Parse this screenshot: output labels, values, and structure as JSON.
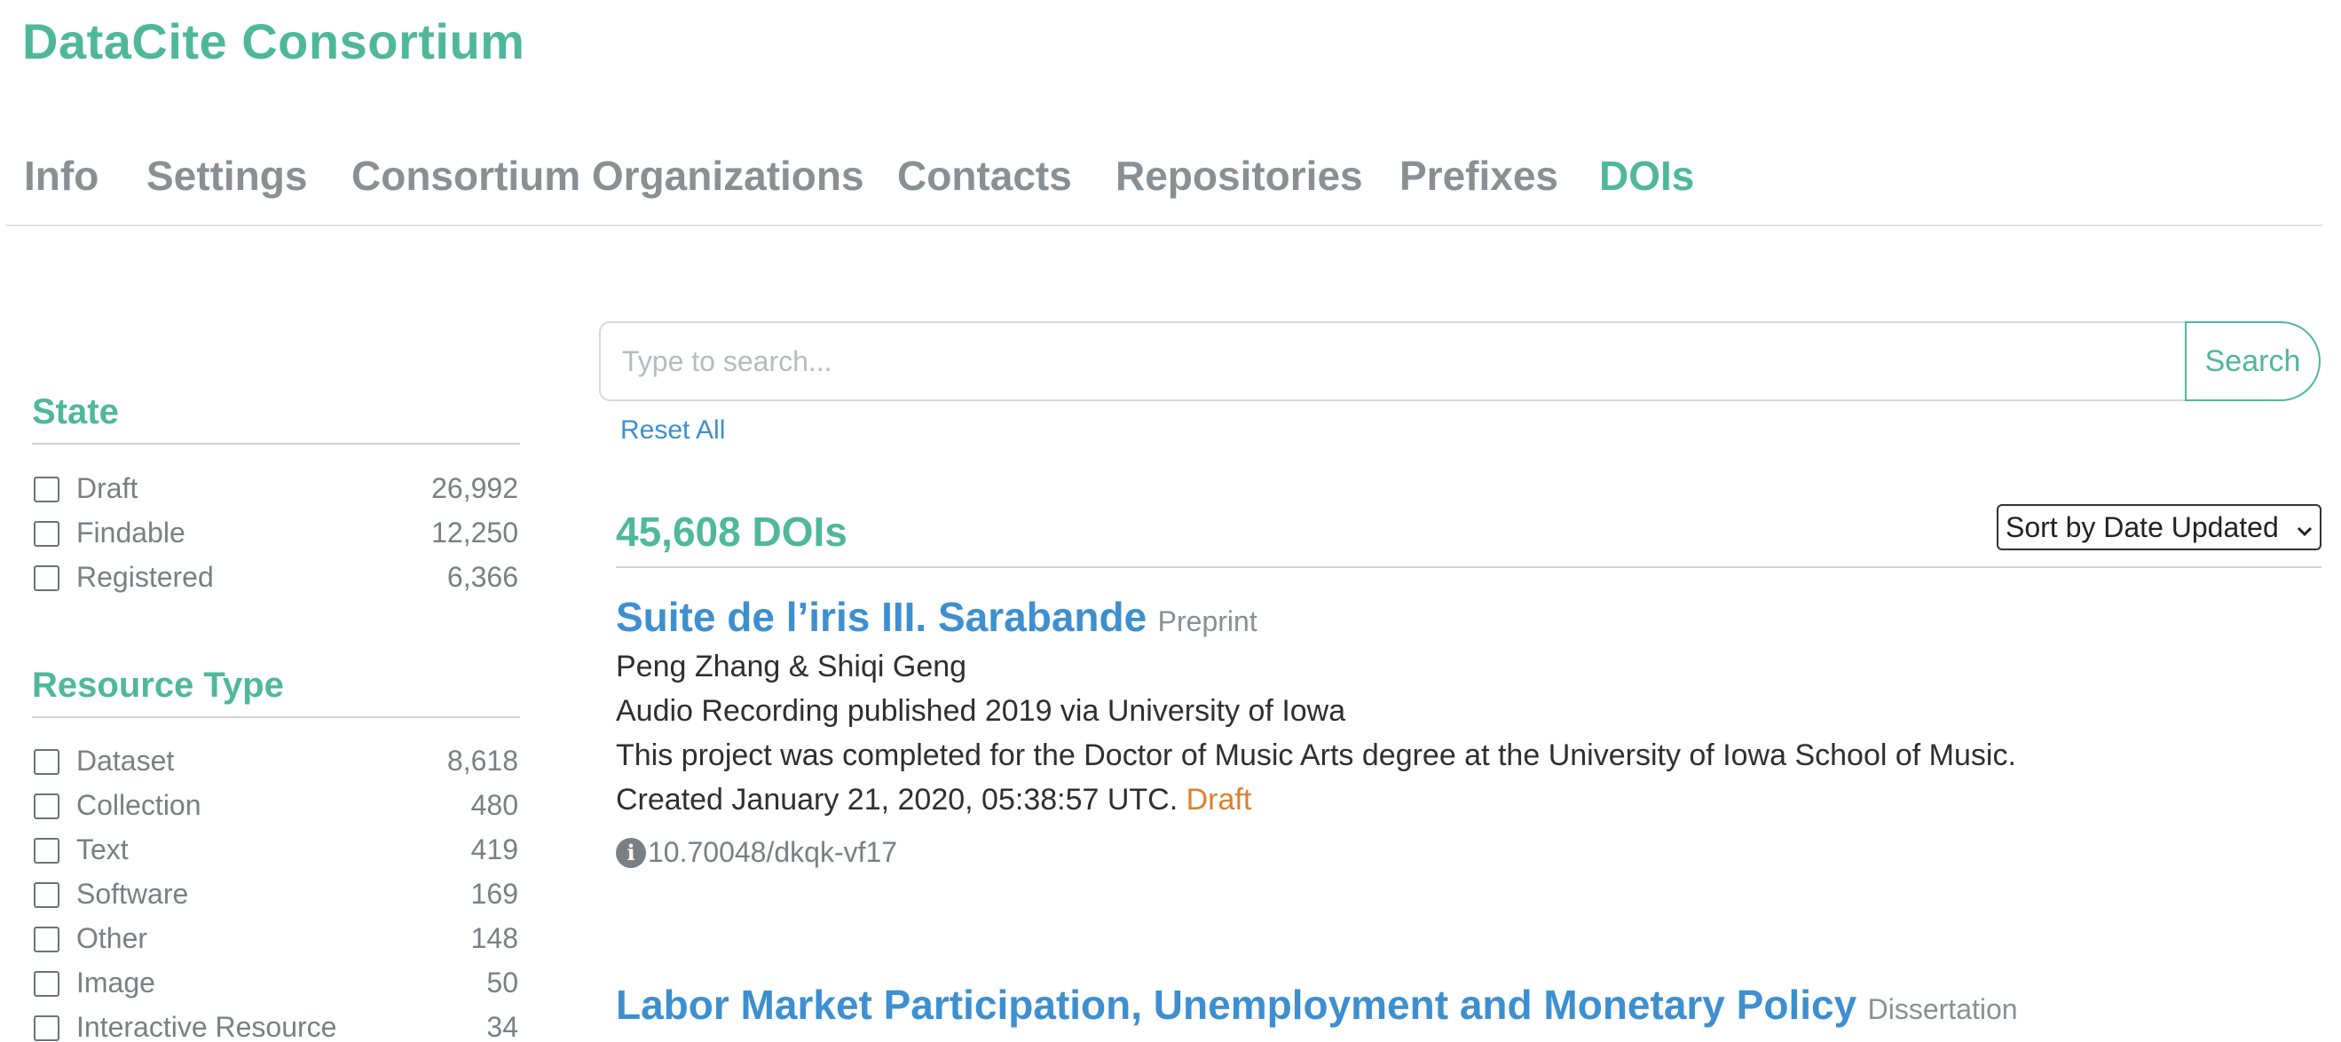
{
  "brand": "DataCite Consortium",
  "tabs": [
    "Info",
    "Settings",
    "Consortium Organizations",
    "Contacts",
    "Repositories",
    "Prefixes",
    "DOIs"
  ],
  "active_tab": "DOIs",
  "facets": {
    "state": {
      "title": "State",
      "items": [
        {
          "label": "Draft",
          "count": "26,992"
        },
        {
          "label": "Findable",
          "count": "12,250"
        },
        {
          "label": "Registered",
          "count": "6,366"
        }
      ]
    },
    "resource_type": {
      "title": "Resource Type",
      "items": [
        {
          "label": "Dataset",
          "count": "8,618"
        },
        {
          "label": "Collection",
          "count": "480"
        },
        {
          "label": "Text",
          "count": "419"
        },
        {
          "label": "Software",
          "count": "169"
        },
        {
          "label": "Other",
          "count": "148"
        },
        {
          "label": "Image",
          "count": "50"
        },
        {
          "label": "Interactive Resource",
          "count": "34"
        }
      ]
    }
  },
  "search": {
    "placeholder": "Type to search...",
    "button_label": "Search",
    "reset_label": "Reset All"
  },
  "results": {
    "count_label": "45,608 DOIs",
    "sort_label": "Sort by Date Updated",
    "items": [
      {
        "title": "Suite de l’iris III. Sarabande",
        "type": "Preprint",
        "creators": "Peng Zhang & Shiqi Geng",
        "published": "Audio Recording published 2019 via University of Iowa",
        "description": "This project was completed for the Doctor of Music Arts degree at the University of Iowa School of Music.",
        "created": "Created January 21, 2020, 05:38:57 UTC.",
        "state": "Draft",
        "doi": "10.70048/dkqk-vf17"
      },
      {
        "title": "Labor Market Participation, Unemployment and Monetary Policy",
        "type": "Dissertation"
      }
    ]
  },
  "colors": {
    "accent": "#4fb89a",
    "link": "#3d8fd0",
    "muted": "#8a8f94",
    "draft": "#e07f2a"
  }
}
